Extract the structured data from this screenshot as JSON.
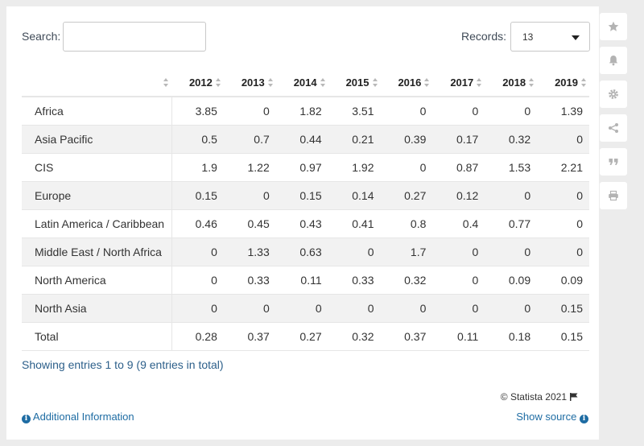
{
  "search": {
    "label": "Search:",
    "value": ""
  },
  "records": {
    "label": "Records:",
    "selected": "13"
  },
  "table": {
    "header_first": "",
    "years": [
      "2012",
      "2013",
      "2014",
      "2015",
      "2016",
      "2017",
      "2018",
      "2019"
    ],
    "rows": [
      {
        "name": "Africa",
        "values": [
          "3.85",
          "0",
          "1.82",
          "3.51",
          "0",
          "0",
          "0",
          "1.39"
        ]
      },
      {
        "name": "Asia Pacific",
        "values": [
          "0.5",
          "0.7",
          "0.44",
          "0.21",
          "0.39",
          "0.17",
          "0.32",
          "0"
        ]
      },
      {
        "name": "CIS",
        "values": [
          "1.9",
          "1.22",
          "0.97",
          "1.92",
          "0",
          "0.87",
          "1.53",
          "2.21"
        ]
      },
      {
        "name": "Europe",
        "values": [
          "0.15",
          "0",
          "0.15",
          "0.14",
          "0.27",
          "0.12",
          "0",
          "0"
        ]
      },
      {
        "name": "Latin America / Caribbean",
        "values": [
          "0.46",
          "0.45",
          "0.43",
          "0.41",
          "0.8",
          "0.4",
          "0.77",
          "0"
        ]
      },
      {
        "name": "Middle East / North Africa",
        "values": [
          "0",
          "1.33",
          "0.63",
          "0",
          "1.7",
          "0",
          "0",
          "0"
        ]
      },
      {
        "name": "North America",
        "values": [
          "0",
          "0.33",
          "0.11",
          "0.33",
          "0.32",
          "0",
          "0.09",
          "0.09"
        ]
      },
      {
        "name": "North Asia",
        "values": [
          "0",
          "0",
          "0",
          "0",
          "0",
          "0",
          "0",
          "0.15"
        ]
      },
      {
        "name": "Total",
        "values": [
          "0.28",
          "0.37",
          "0.27",
          "0.32",
          "0.37",
          "0.11",
          "0.18",
          "0.15"
        ]
      }
    ]
  },
  "chart_data": {
    "type": "table",
    "columns": [
      "2012",
      "2013",
      "2014",
      "2015",
      "2016",
      "2017",
      "2018",
      "2019"
    ],
    "rows": [
      "Africa",
      "Asia Pacific",
      "CIS",
      "Europe",
      "Latin America / Caribbean",
      "Middle East / North Africa",
      "North America",
      "North Asia",
      "Total"
    ],
    "values": [
      [
        3.85,
        0,
        1.82,
        3.51,
        0,
        0,
        0,
        1.39
      ],
      [
        0.5,
        0.7,
        0.44,
        0.21,
        0.39,
        0.17,
        0.32,
        0
      ],
      [
        1.9,
        1.22,
        0.97,
        1.92,
        0,
        0.87,
        1.53,
        2.21
      ],
      [
        0.15,
        0,
        0.15,
        0.14,
        0.27,
        0.12,
        0,
        0
      ],
      [
        0.46,
        0.45,
        0.43,
        0.41,
        0.8,
        0.4,
        0.77,
        0
      ],
      [
        0,
        1.33,
        0.63,
        0,
        1.7,
        0,
        0,
        0
      ],
      [
        0,
        0.33,
        0.11,
        0.33,
        0.32,
        0,
        0.09,
        0.09
      ],
      [
        0,
        0,
        0,
        0,
        0,
        0,
        0,
        0.15
      ],
      [
        0.28,
        0.37,
        0.27,
        0.32,
        0.37,
        0.11,
        0.18,
        0.15
      ]
    ]
  },
  "footer": {
    "showing": "Showing entries 1 to 9 (9 entries in total)",
    "copyright": "© Statista 2021",
    "additional_info": "Additional Information",
    "show_source": "Show source"
  },
  "sidebar": {
    "icons": [
      "star-icon",
      "bell-icon",
      "gear-icon",
      "share-icon",
      "quote-icon",
      "print-icon"
    ]
  },
  "colors": {
    "link": "#1e6ca3",
    "row_shade": "#f2f2f2",
    "background": "#ececec"
  }
}
